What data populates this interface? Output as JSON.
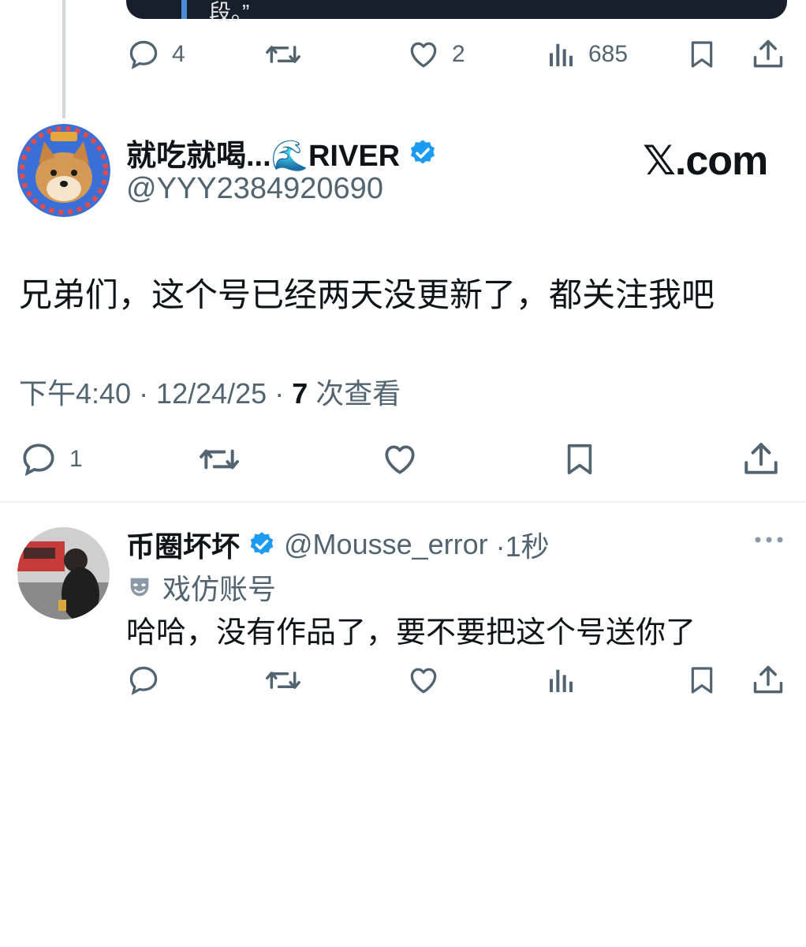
{
  "quoted_card": {
    "text": "段。”"
  },
  "prev_tweet_actions": {
    "reply_count": "4",
    "like_count": "2",
    "views_count": "685"
  },
  "main_tweet": {
    "display_name": "就吃就喝...🌊RIVER",
    "handle": "@YYY2384920690",
    "watermark": "𝕏.com",
    "text": "兄弟们，这个号已经两天没更新了，都关注我吧",
    "time": "下午4:40 · 12/24/25 · ",
    "views_number": "7",
    "views_label": " 次查看",
    "reply_count": "1"
  },
  "reply_tweet": {
    "display_name": "币圈坏坏",
    "handle": "@Mousse_error",
    "time_ago": "·1秒",
    "parody_label": "戏仿账号",
    "text": "哈哈，没有作品了，要不要把这个号送你了"
  },
  "colors": {
    "verified": "#1d9bf0",
    "muted": "#536471",
    "text": "#0f1419",
    "divider": "#eff3f4"
  },
  "icons": [
    "reply-icon",
    "retweet-icon",
    "like-icon",
    "views-icon",
    "bookmark-icon",
    "share-icon",
    "verified-badge-icon",
    "more-icon",
    "parody-mask-icon"
  ]
}
